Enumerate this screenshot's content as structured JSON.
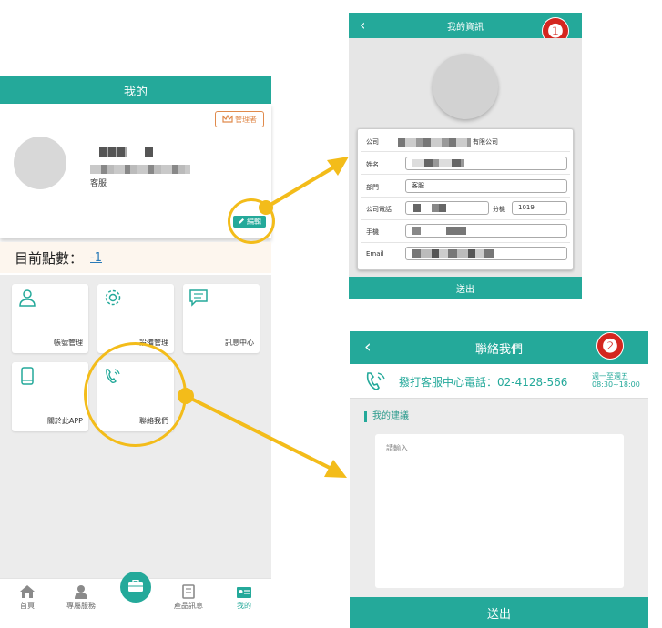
{
  "colors": {
    "teal": "#24a99a",
    "highlight": "#f3bc1a",
    "badge_red": "#d4261f"
  },
  "my_page": {
    "title": "我的",
    "admin_badge": "管理者",
    "department": "客服",
    "edit_label": "編輯",
    "points_label": "目前點數：",
    "points_value": "-1",
    "tiles": [
      {
        "label": "帳號管理",
        "icon": "person-icon"
      },
      {
        "label": "設備管理",
        "icon": "gear-icon"
      },
      {
        "label": "訊息中心",
        "icon": "message-icon"
      },
      {
        "label": "關於此APP",
        "icon": "phone-device-icon"
      },
      {
        "label": "聯絡我們",
        "icon": "phone-call-icon"
      }
    ],
    "nav": [
      {
        "label": "首頁",
        "icon": "home-icon"
      },
      {
        "label": "專屬服務",
        "icon": "person-service-icon"
      },
      {
        "label": "",
        "icon": "briefcase-icon"
      },
      {
        "label": "產品訊息",
        "icon": "document-icon"
      },
      {
        "label": "我的",
        "icon": "id-card-icon"
      }
    ]
  },
  "my_info": {
    "title": "我的資訊",
    "badge": "❶",
    "company_label": "公司",
    "company_suffix": "有限公司",
    "name_label": "姓名",
    "dept_label": "部門",
    "dept_value": "客服",
    "phone_label": "公司電話",
    "ext_label": "分機",
    "ext_value": "1019",
    "mobile_label": "手機",
    "email_label": "Email",
    "submit": "送出"
  },
  "contact_us": {
    "title": "聯絡我們",
    "badge": "❷",
    "hotline": "撥打客服中心電話：02-4128-566",
    "hours_days": "週一至週五",
    "hours_time": "08:30~18:00",
    "suggestion_title": "我的建議",
    "placeholder": "請輸入",
    "submit": "送出"
  }
}
